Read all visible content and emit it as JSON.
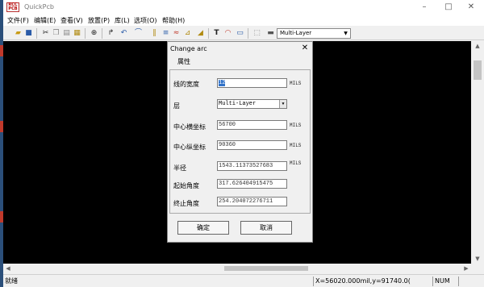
{
  "app": {
    "title": "QuickPcb",
    "logo_text": "RCC PCB"
  },
  "window_controls": [
    "–",
    "□",
    "✕"
  ],
  "menu": [
    "文件(F)",
    "编辑(E)",
    "查看(V)",
    "放置(P)",
    "库(L)",
    "选项(O)",
    "帮助(H)"
  ],
  "toolbar": {
    "layer_value": "Multi-Layer"
  },
  "dialog": {
    "title": "Change arc",
    "close": "✕",
    "tab": "属性",
    "fields": {
      "width_label": "线的宽度",
      "width_value": "12",
      "width_unit": "MILS",
      "layer_label": "层",
      "layer_value": "Multi-Layer",
      "cx_label": "中心横坐标",
      "cx_value": "56700",
      "cx_unit": "MILS",
      "cy_label": "中心纵坐标",
      "cy_value": "90360",
      "cy_unit": "MILS",
      "radius_label": "半径",
      "radius_value": "1543.11373527683",
      "radius_unit": "MILS",
      "start_label": "起始角度",
      "start_value": "317.626404915475",
      "end_label": "终止角度",
      "end_value": "254.204072276711"
    },
    "ok_label": "确定",
    "cancel_label": "取消"
  },
  "status": {
    "ready": "就绪",
    "coords": "X=56020.000mil,y=91740.0(",
    "num": "NUM"
  },
  "colors": {
    "canvas": "#000000",
    "selection": "#3172c8"
  }
}
